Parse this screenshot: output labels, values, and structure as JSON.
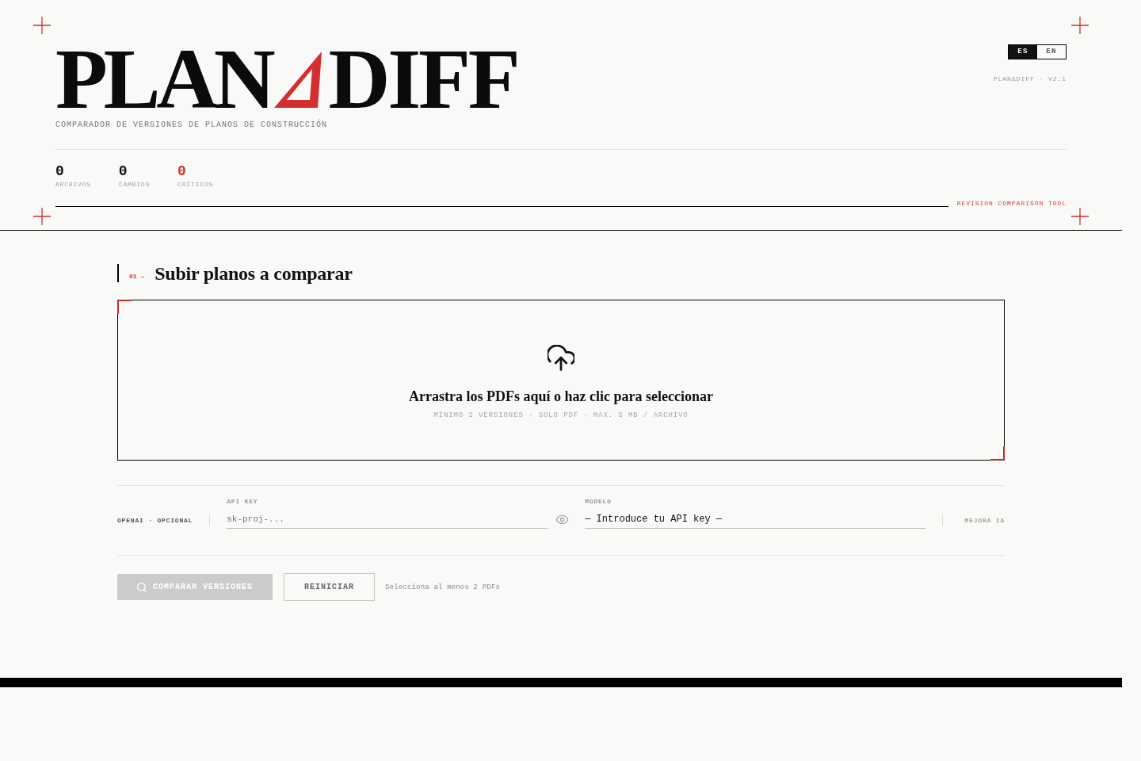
{
  "header": {
    "logo": {
      "left": "PLAN",
      "right": "DIFF"
    },
    "tagline": "COMPARADOR DE VERSIONES DE PLANOS DE CONSTRUCCIÓN",
    "language_tabs": [
      {
        "label": "ES",
        "selected": true
      },
      {
        "label": "EN",
        "selected": false
      }
    ],
    "version": "PLANΔDIFF · V2.1",
    "stats": [
      {
        "value": "0",
        "label": "ARCHIVOS",
        "color": "#111111"
      },
      {
        "value": "0",
        "label": "CAMBIOS",
        "color": "#111111"
      },
      {
        "value": "0",
        "label": "CRÍTICOS",
        "color": "#d32f2f"
      }
    ],
    "tool_label": "REVISION COMPARISON TOOL"
  },
  "section": {
    "number": "01 –",
    "title": "Subir planos a comparar"
  },
  "dropzone": {
    "title": "Arrastra los PDFs aquí o haz clic para seleccionar",
    "hint": "MÍNIMO 2 VERSIONES · SOLO PDF · MÁX. 5 MB / ARCHIVO"
  },
  "ai_settings": {
    "label": "OPENAI · OPCIONAL",
    "api_key": {
      "label": "API KEY",
      "placeholder": "sk-proj-..."
    },
    "model": {
      "label": "MODELO",
      "value": "— Introduce tu API key —"
    },
    "enhance": {
      "label": "MEJORA IA",
      "disabled": true
    }
  },
  "actions": {
    "buttons": [
      {
        "label": "COMPARAR VERSIONES",
        "kind": "primary",
        "disabled": true
      },
      {
        "label": "REINICIAR",
        "kind": "secondary",
        "disabled": false
      }
    ],
    "hint": "Selecciona al menos 2 PDFs"
  }
}
